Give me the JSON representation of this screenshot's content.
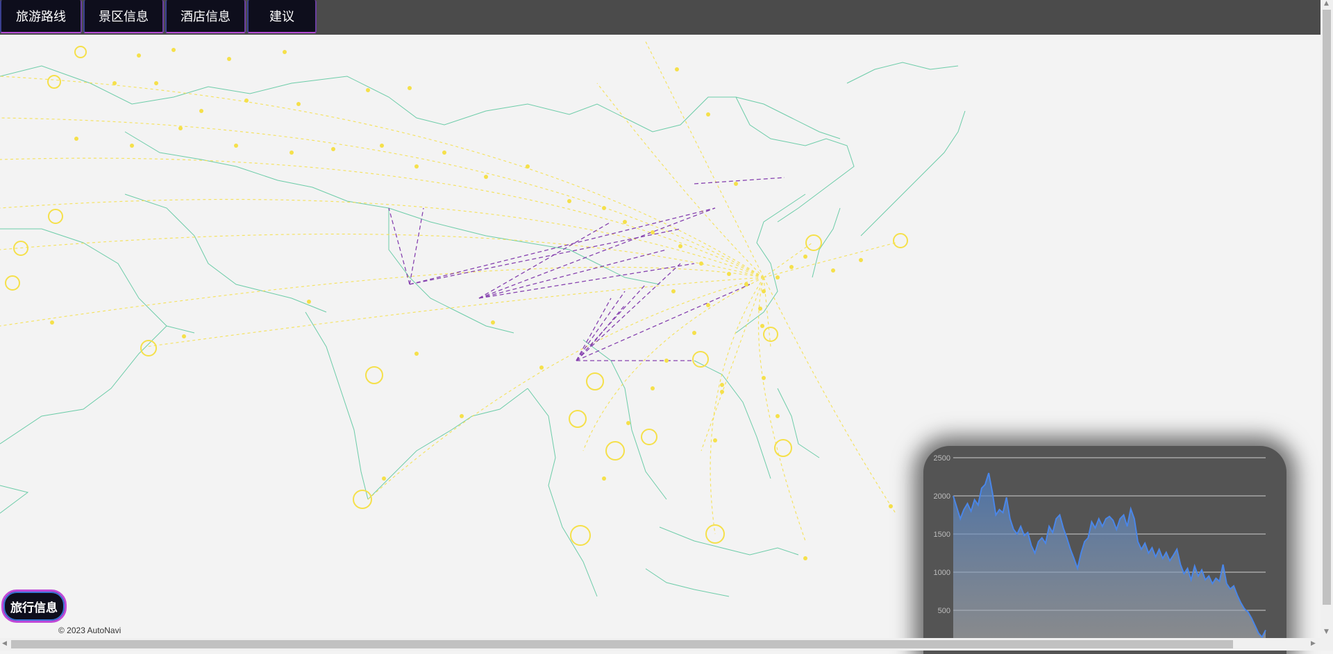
{
  "nav": {
    "items": [
      {
        "label": "旅游路线"
      },
      {
        "label": "景区信息"
      },
      {
        "label": "酒店信息"
      },
      {
        "label": "建议"
      }
    ]
  },
  "travel_info_button": "旅行信息",
  "copyright": "© 2023 AutoNavi",
  "colors": {
    "topbar": "#4b4b4b",
    "map_bg": "#f3f3f3",
    "borders": "#3fbf8f",
    "flight_lines": "#f5e04a",
    "routes": "#7b2fa8",
    "chart_line": "#4a86e8",
    "panel": "#545454"
  },
  "chart_data": {
    "type": "area",
    "yticks": [
      500,
      1000,
      1500,
      2000,
      2500
    ],
    "ylim": [
      0,
      2500
    ],
    "grid": true,
    "values": [
      2000,
      1850,
      1700,
      1820,
      1900,
      1800,
      1950,
      1880,
      2100,
      2150,
      2300,
      2050,
      1750,
      1820,
      1780,
      1980,
      1700,
      1560,
      1500,
      1600,
      1480,
      1520,
      1350,
      1250,
      1400,
      1450,
      1380,
      1600,
      1520,
      1700,
      1750,
      1580,
      1450,
      1300,
      1180,
      1050,
      1250,
      1400,
      1450,
      1660,
      1580,
      1700,
      1600,
      1700,
      1730,
      1680,
      1560,
      1700,
      1750,
      1600,
      1830,
      1700,
      1400,
      1300,
      1380,
      1250,
      1320,
      1200,
      1300,
      1180,
      1260,
      1150,
      1220,
      1300,
      1100,
      980,
      1050,
      900,
      1080,
      950,
      1030,
      900,
      950,
      850,
      920,
      880,
      1100,
      850,
      780,
      820,
      700,
      600,
      520,
      480,
      400,
      300,
      200,
      150,
      240
    ]
  }
}
